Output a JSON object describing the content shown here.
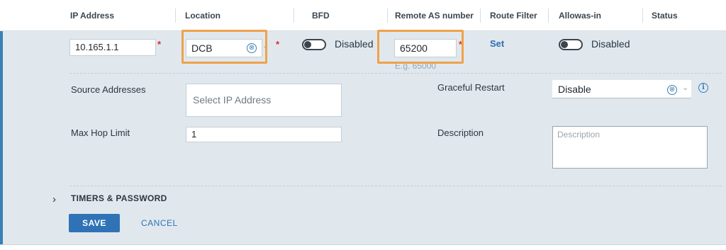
{
  "table": {
    "columns": [
      {
        "label": "IP Address"
      },
      {
        "label": "Location"
      },
      {
        "label": "BFD"
      },
      {
        "label": "Remote AS number"
      },
      {
        "label": "Route Filter"
      },
      {
        "label": "Allowas-in"
      },
      {
        "label": "Status"
      }
    ]
  },
  "row": {
    "ip_address": "10.165.1.1",
    "location": "DCB",
    "bfd_label": "Disabled",
    "remote_as": "65200",
    "remote_as_hint": "E.g. 65000",
    "route_filter_link": "Set",
    "allowas_in_label": "Disabled",
    "required_marker": "*",
    "clear_glyph": "⊗",
    "chevron_glyph": "⌄"
  },
  "details": {
    "source_addresses_label": "Source Addresses",
    "source_addresses_placeholder": "Select IP Address",
    "max_hop_label": "Max Hop Limit",
    "max_hop_value": "1",
    "graceful_restart_label": "Graceful Restart",
    "graceful_restart_value": "Disable",
    "description_label": "Description",
    "description_placeholder": "Description",
    "info_glyph": "i"
  },
  "timers": {
    "chevron": "›",
    "label": "TIMERS & PASSWORD"
  },
  "actions": {
    "save_label": "SAVE",
    "cancel_label": "CANCEL"
  },
  "colors": {
    "accent": "#2f73b6",
    "panel_bg": "#e0e8ee",
    "highlight": "#f0a24a",
    "required": "#d93025"
  }
}
